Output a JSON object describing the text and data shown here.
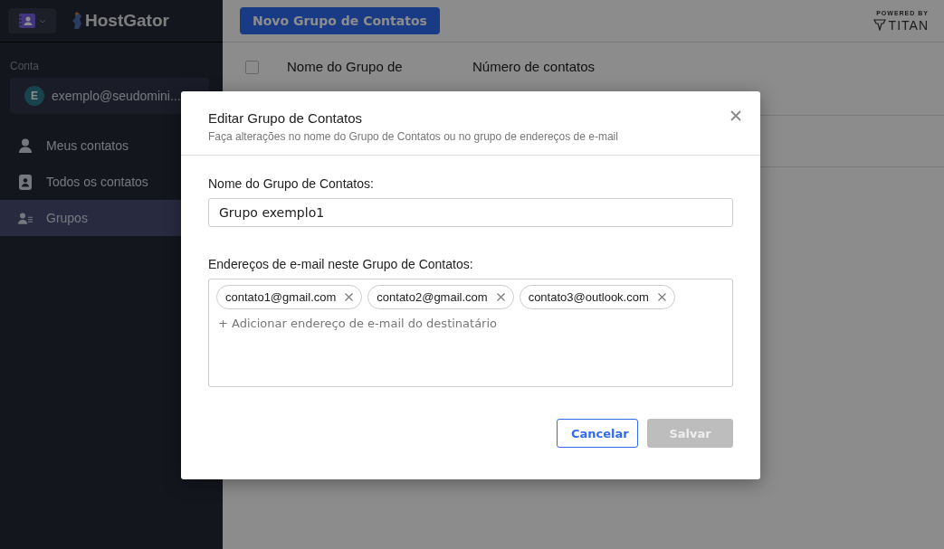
{
  "sidebar": {
    "brand": "HostGator",
    "account_label": "Conta",
    "account": {
      "initial": "E",
      "email": "exemplo@seudomini..."
    },
    "items": [
      {
        "label": "Meus contatos",
        "selected": false
      },
      {
        "label": "Todos os contatos",
        "selected": false
      },
      {
        "label": "Grupos",
        "selected": true
      }
    ]
  },
  "toolbar": {
    "new_group_button": "Novo Grupo de Contatos",
    "powered_by": "POWERED BY",
    "powered_brand": "TITAN"
  },
  "table": {
    "select_all_checked": false,
    "columns": [
      "Nome do Grupo de",
      "Número de contatos"
    ]
  },
  "dialog": {
    "title": "Editar Grupo de Contatos",
    "subtitle": "Faça alterações no nome do Grupo de Contatos ou no grupo de endereços de e-mail",
    "name_label": "Nome do Grupo de Contatos:",
    "name_value": "Grupo exemplo1",
    "emails_label": "Endereços de e-mail neste Grupo de Contatos:",
    "emails": [
      "contato1@gmail.com",
      "contato2@gmail.com",
      "contato3@outlook.com"
    ],
    "add_placeholder": "+ Adicionar endereço de e-mail do destinatário",
    "buttons": [
      {
        "label": "Cancelar",
        "kind": "secondary",
        "disabled": false
      },
      {
        "label": "Salvar",
        "kind": "primary",
        "disabled": true
      }
    ]
  }
}
